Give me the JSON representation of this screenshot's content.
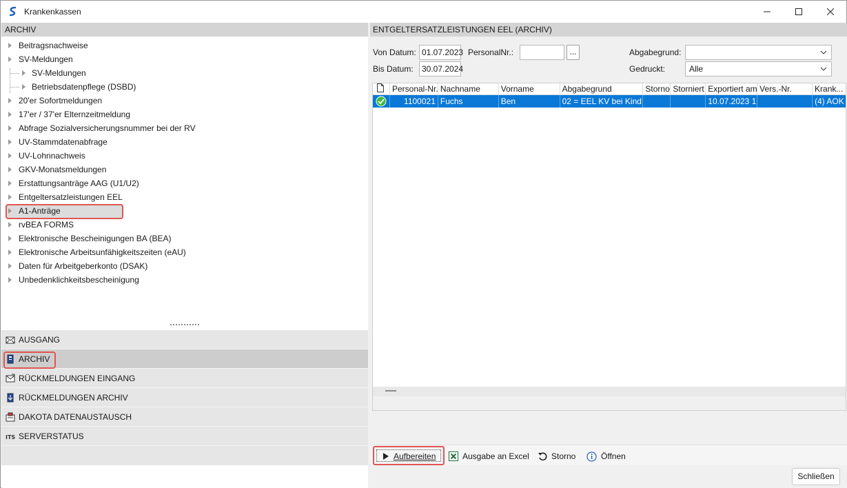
{
  "window": {
    "title": "Krankenkassen"
  },
  "left": {
    "header": "ARCHIV",
    "tree": [
      {
        "label": "Beitragsnachweise"
      },
      {
        "label": "SV-Meldungen"
      },
      {
        "label": "SV-Meldungen",
        "child": true
      },
      {
        "label": "Betriebsdatenpflege (DSBD)",
        "child": true
      },
      {
        "label": "20'er Sofortmeldungen"
      },
      {
        "label": "17'er / 37'er Elternzeitmeldung"
      },
      {
        "label": "Abfrage Sozialversicherungsnummer bei der RV"
      },
      {
        "label": "UV-Stammdatenabfrage"
      },
      {
        "label": "UV-Lohnnachweis"
      },
      {
        "label": "GKV-Monatsmeldungen"
      },
      {
        "label": "Erstattungsanträge AAG (U1/U2)"
      },
      {
        "label": "Entgeltersatzleistungen EEL",
        "selected": true
      },
      {
        "label": "A1-Anträge"
      },
      {
        "label": "rvBEA FORMS"
      },
      {
        "label": "Elektronische Bescheinigungen BA (BEA)"
      },
      {
        "label": "Elektronische Arbeitsunfähigkeitszeiten (eAU)"
      },
      {
        "label": "Daten für Arbeitgeberkonto (DSAK)"
      },
      {
        "label": "Unbedenklichkeitsbescheinigung"
      }
    ],
    "nav": [
      {
        "label": "AUSGANG",
        "icon": "mail-outbox-icon"
      },
      {
        "label": "ARCHIV",
        "icon": "archive-icon",
        "active": true
      },
      {
        "label": "RÜCKMELDUNGEN EINGANG",
        "icon": "mail-inbox-icon"
      },
      {
        "label": "RÜCKMELDUNGEN ARCHIV",
        "icon": "download-archive-icon"
      },
      {
        "label": "DAKOTA DATENAUSTAUSCH",
        "icon": "data-exchange-icon"
      },
      {
        "label": "SERVERSTATUS",
        "icon": "server-status-icon"
      }
    ]
  },
  "right": {
    "header": "ENTGELTERSATZLEISTUNGEN EEL (ARCHIV)",
    "filters": {
      "von_label": "Von Datum:",
      "von_value": "01.07.2023",
      "bis_label": "Bis Datum:",
      "bis_value": "30.07.2024",
      "personal_label": "PersonalNr.:",
      "personal_value": "",
      "dots_label": "...",
      "abgabegrund_label": "Abgabegrund:",
      "abgabegrund_value": "",
      "gedruckt_label": "Gedruckt:",
      "gedruckt_value": "Alle"
    },
    "table": {
      "columns": [
        "Personal-Nr.",
        "Nachname",
        "Vorname",
        "Abgabegrund",
        "Storno",
        "Storniert",
        "Exportiert am",
        "Vers.-Nr.",
        "Krank..."
      ],
      "rows": [
        {
          "status": "ok",
          "personal_nr": "1100021",
          "nachname": "Fuchs",
          "vorname": "Ben",
          "abgabegrund": "02 = EEL KV bei Kind...",
          "storno": "",
          "storniert": "",
          "exportiert": "10.07.2023 1...",
          "vers_nr": "",
          "krank": "(4) AOK"
        }
      ]
    },
    "toolbar": {
      "aufbereiten": "Aufbereiten",
      "excel": "Ausgabe an Excel",
      "storno": "Storno",
      "oeffnen": "Öffnen"
    }
  },
  "footer": {
    "close": "Schließen"
  },
  "colors": {
    "selection": "#0a78d7",
    "highlight_box": "#e05555",
    "header_bg": "#d4d4d4"
  }
}
